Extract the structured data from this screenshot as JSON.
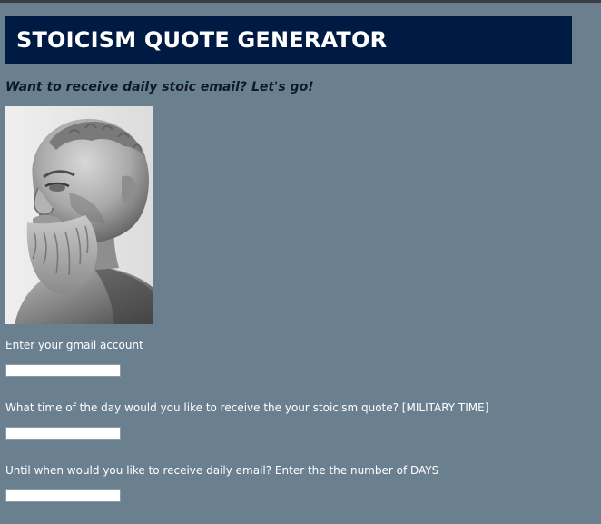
{
  "header": {
    "title": "STOICISM QUOTE GENERATOR"
  },
  "intro": {
    "text": "Want to receive daily stoic email? Let's go!"
  },
  "form": {
    "fields": [
      {
        "label": "Enter your gmail account",
        "value": ""
      },
      {
        "label": "What time of the day would you like to receive the your stoicism quote? [MILITARY TIME]",
        "value": ""
      },
      {
        "label": "Until when would you like to receive daily email? Enter the the number of DAYS",
        "value": ""
      }
    ]
  },
  "colors": {
    "page_background": "#6b808f",
    "header_background": "#001b43",
    "header_text": "#ffffff",
    "intro_text": "#0e1a2a",
    "label_text": "#ffffff",
    "field_background": "#ffffff"
  },
  "images": {
    "portrait": "marble-bust-of-bearded-philosopher"
  }
}
